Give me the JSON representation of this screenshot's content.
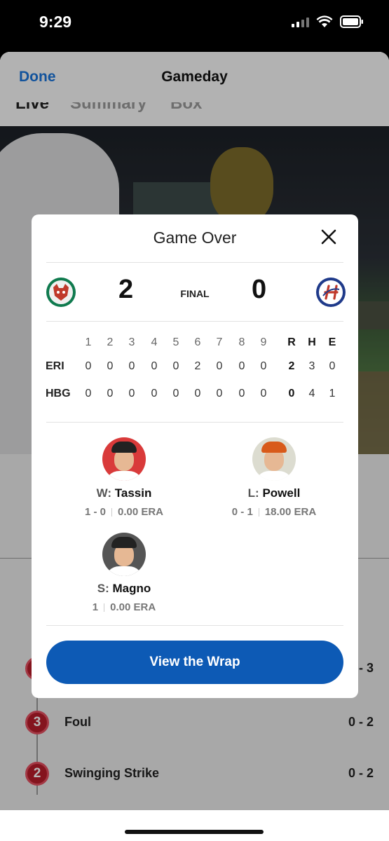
{
  "status_bar": {
    "time": "9:29"
  },
  "sheet": {
    "done_label": "Done",
    "title": "Gameday"
  },
  "tabs": [
    {
      "label": "Live",
      "active": true
    },
    {
      "label": "Summary",
      "active": false
    },
    {
      "label": "Box",
      "active": false
    }
  ],
  "play_by_play": [
    {
      "number": "4",
      "description": "",
      "count": "- 3"
    },
    {
      "number": "3",
      "description": "Foul",
      "count": "0 - 2"
    },
    {
      "number": "2",
      "description": "Swinging Strike",
      "count": "0 - 2"
    }
  ],
  "modal": {
    "title": "Game Over",
    "status": "FINAL",
    "away": {
      "abbr": "ERI",
      "score": "2",
      "logo_icon": "erie-seawolves-logo",
      "color": "#0f7a4e"
    },
    "home": {
      "abbr": "HBG",
      "score": "0",
      "logo_icon": "harrisburg-senators-logo",
      "color": "#1f3a8a"
    },
    "linescore": {
      "headers": [
        "1",
        "2",
        "3",
        "4",
        "5",
        "6",
        "7",
        "8",
        "9",
        "R",
        "H",
        "E"
      ],
      "rows": [
        {
          "team": "ERI",
          "innings": [
            "0",
            "0",
            "0",
            "0",
            "0",
            "2",
            "0",
            "0",
            "0"
          ],
          "r": "2",
          "h": "3",
          "e": "0"
        },
        {
          "team": "HBG",
          "innings": [
            "0",
            "0",
            "0",
            "0",
            "0",
            "0",
            "0",
            "0",
            "0"
          ],
          "r": "0",
          "h": "4",
          "e": "1"
        }
      ]
    },
    "pitchers": {
      "win": {
        "prefix": "W:",
        "name": "Tassin",
        "record": "1 - 0",
        "era": "0.00 ERA",
        "bg": "#d93a3a"
      },
      "loss": {
        "prefix": "L:",
        "name": "Powell",
        "record": "0 - 1",
        "era": "18.00 ERA",
        "bg": "#dcdcd0"
      },
      "save": {
        "prefix": "S:",
        "name": "Magno",
        "record": "1",
        "era": "0.00 ERA",
        "bg": "#555555"
      }
    },
    "wrap_button": "View the Wrap"
  }
}
